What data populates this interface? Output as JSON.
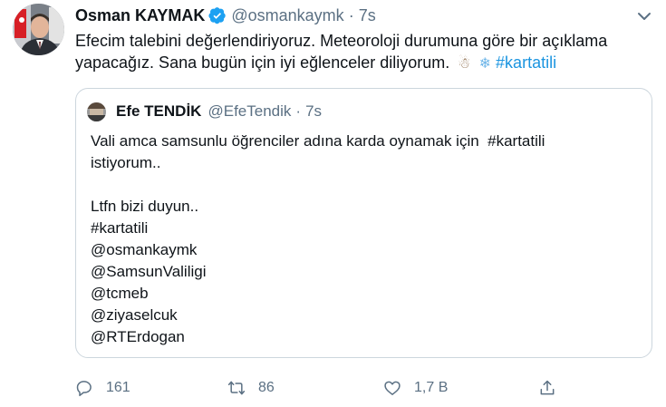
{
  "tweet": {
    "author_name": "Osman KAYMAK",
    "handle": "@osmankaymk",
    "separator": "·",
    "time": "7s",
    "text_parts": [
      "Efecim talebini değerlendiriyoruz. Meteoroloji durumuna göre bir açıklama yapacağız. Sana bugün için iyi eğlenceler diliyorum.",
      "#kartatili"
    ],
    "emoji": [
      "snowman-emoji",
      "snowflake-emoji"
    ],
    "emoji_glyphs": [
      "☃",
      "❄"
    ]
  },
  "quoted_tweet": {
    "author_name": "Efe TENDİK",
    "handle": "@EfeTendik",
    "separator": "·",
    "time": "7s",
    "lines": [
      "Vali amca samsunlu öğrenciler adına karda oynamak için  #kartatili",
      "istiyorum..",
      "",
      "Ltfn bizi duyun..",
      "#kartatili",
      "@osmankaymk",
      "@SamsunValiligi",
      "@tcmeb",
      "@ziyaselcuk",
      "@RTErdogan"
    ]
  },
  "actions": {
    "reply_count": "161",
    "retweet_count": "86",
    "like_count": "1,7 B"
  },
  "icons": [
    "verified-badge-icon",
    "chevron-down-icon",
    "reply-icon",
    "retweet-icon",
    "like-icon",
    "share-icon"
  ],
  "colors": {
    "link": "#1b95e0",
    "verified": "#1da1f2",
    "muted": "#5b7083",
    "border": "#ccd6dd",
    "text": "#0f1419"
  }
}
